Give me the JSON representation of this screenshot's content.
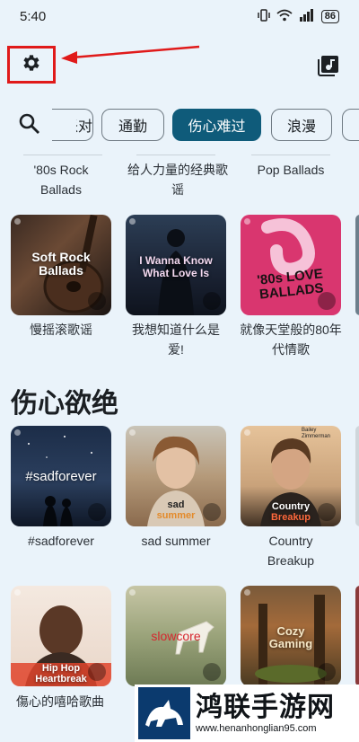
{
  "status_bar": {
    "time": "5:40",
    "battery": "86"
  },
  "chips": [
    {
      "label": "派对",
      "active": false
    },
    {
      "label": "通勤",
      "active": false
    },
    {
      "label": "伤心难过",
      "active": true
    },
    {
      "label": "浪漫",
      "active": false
    },
    {
      "label": "",
      "active": false
    }
  ],
  "row1_captions": [
    "'80s Rock Ballads",
    "给人力量的经典歌谣",
    "Pop Ballads"
  ],
  "row2": [
    {
      "cover_text": "Soft Rock Ballads",
      "caption": "慢摇滚歌谣"
    },
    {
      "cover_text": "I Wanna Know What Love Is",
      "caption": "我想知道什么是爱!"
    },
    {
      "cover_text": "'80s LOVE BALLADS",
      "caption": "就像天堂般的80年代情歌"
    }
  ],
  "section": {
    "title": "伤心欲绝"
  },
  "row3": [
    {
      "cover_text": "#sadforever",
      "caption": "#sadforever"
    },
    {
      "cover_text_1": "sad",
      "cover_text_2": "summer",
      "caption": "sad summer"
    },
    {
      "cover_text_1": "Country",
      "cover_text_2": "Breakup",
      "caption": "Country Breakup",
      "corner_text": "Bailey Zimmerman"
    }
  ],
  "row4": [
    {
      "cover_text_1": "Hip Hop",
      "cover_text_2": "Heartbreak",
      "caption": "傷心的嘻哈歌曲"
    },
    {
      "cover_text": "slowcore"
    },
    {
      "cover_text": "Cozy Gaming"
    }
  ],
  "watermark": {
    "name": "鸿联手游网",
    "url": "www.henanhonglian95.com"
  },
  "colors": {
    "accent": "#0f5b7a",
    "background": "#eaf3fa",
    "annotation": "#e01a1a"
  }
}
